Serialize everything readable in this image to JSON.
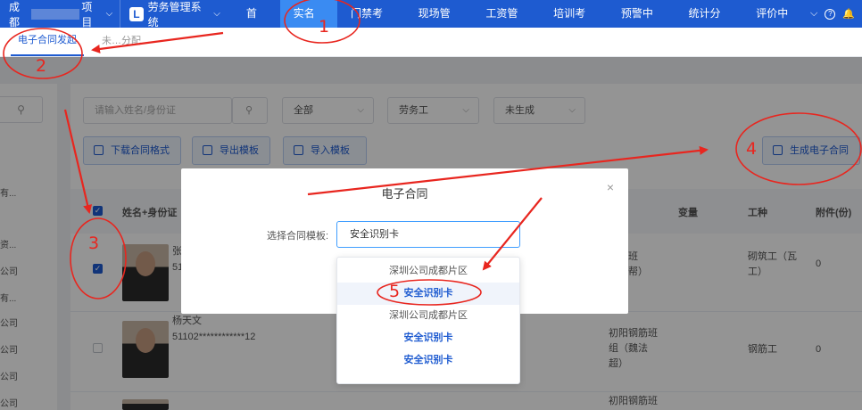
{
  "topnav": {
    "project_prefix": "成都",
    "project_suffix": "项目",
    "system_logo": "L",
    "system_name": "劳务管理系统",
    "menu": [
      "首页",
      "实名制",
      "门禁考勤",
      "现场管理",
      "工资管理",
      "培训考试",
      "预警中心",
      "统计分析",
      "评价中心"
    ],
    "active_menu": "实名制",
    "help_symbol": "?",
    "bell_symbol": "🔔"
  },
  "subtabs": {
    "tab1": "电子合同发起",
    "tab2": "未…分配"
  },
  "sidebar": {
    "items": [
      "有...",
      "资...",
      "公司",
      "有...",
      "公司",
      "公司",
      "公司",
      "公司"
    ]
  },
  "filters": {
    "search_placeholder": "请输入姓名/身份证",
    "status_select": "全部",
    "worker_type_select": "劳务工",
    "generated_select": "未生成"
  },
  "buttons": {
    "download_format": "下载合同格式",
    "export_template": "导出模板",
    "import_template": "导入模板",
    "generate_contract": "生成电子合同"
  },
  "table": {
    "headers": {
      "name_id": "姓名+身份证",
      "team": "变量",
      "trade": "工种",
      "attachments": "附件(份)"
    },
    "rows": [
      {
        "name": "张",
        "id": "51",
        "team": "砌筑班\n（小帮）",
        "trade": "砌筑工（瓦\n工）",
        "attachments": "0",
        "checked": true
      },
      {
        "name": "杨天文",
        "id": "51102************12",
        "team": "初阳钢筋班\n组（魏法\n超）",
        "trade": "钢筋工",
        "attachments": "0",
        "checked": false
      },
      {
        "name": "",
        "id": "",
        "team": "初阳钢筋班",
        "trade": "",
        "attachments": "",
        "checked": false
      }
    ]
  },
  "dialog": {
    "title": "电子合同",
    "close": "×",
    "template_label": "选择合同模板:",
    "template_value": "安全识别卡"
  },
  "dropdown": {
    "options": [
      "深圳公司成都片区",
      "安全识别卡",
      "深圳公司成都片区",
      "安全识别卡",
      "安全识别卡"
    ]
  },
  "annotations": {
    "numbers": [
      "1",
      "2",
      "3",
      "4",
      "5"
    ],
    "color": "#e8261f"
  },
  "colors": {
    "nav_bg": "#1e5bd0",
    "active_tab": "#3a8bf2"
  }
}
